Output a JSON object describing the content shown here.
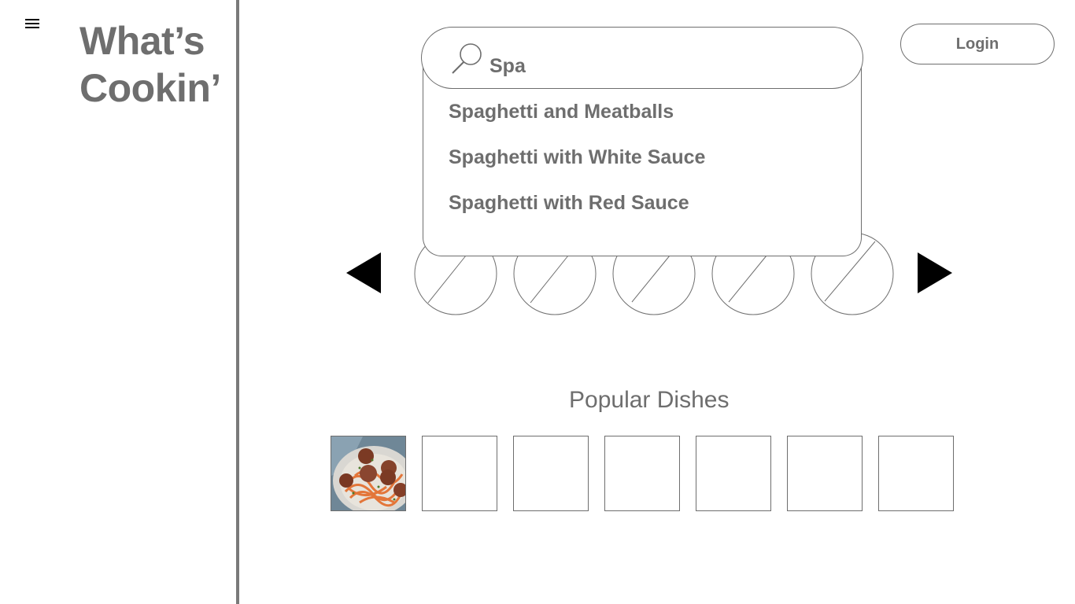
{
  "app": {
    "logo_line1": "What’s",
    "logo_line2": "Cookin’"
  },
  "icons": {
    "menu": "hamburger-menu-icon",
    "search": "magnifier-icon",
    "prev": "triangle-left-icon",
    "next": "triangle-right-icon",
    "placeholder": "image-placeholder-icon",
    "dish_image": "spaghetti-meatballs-photo"
  },
  "search": {
    "value": "Spa",
    "suggestions": [
      "Spaghetti and Meatballs",
      "Spaghetti with White Sauce",
      "Spaghetti with Red Sauce"
    ]
  },
  "header": {
    "login_label": "Login"
  },
  "popular": {
    "heading": "Popular Dishes"
  },
  "colors": {
    "text_gray": "#6e6e6e",
    "border_gray": "#6e6e6e",
    "arrow": "#000000"
  }
}
